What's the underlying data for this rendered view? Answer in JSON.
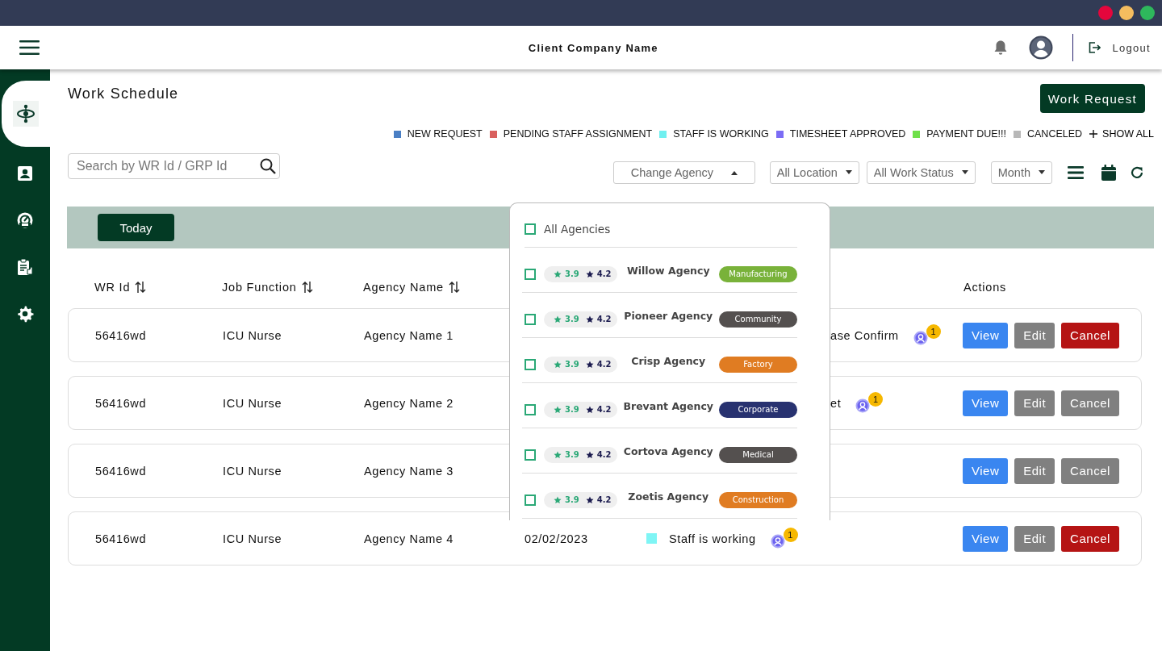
{
  "window": {
    "controls": [
      {
        "color": "#e5063c"
      },
      {
        "color": "#f5bd5f"
      },
      {
        "color": "#2eb85c"
      }
    ]
  },
  "header": {
    "company": "Client Company Name",
    "logout": "Logout"
  },
  "sidebar": {
    "items": [
      {
        "kind": "hub",
        "selected": true
      },
      {
        "kind": "contact",
        "selected": false
      },
      {
        "kind": "gauge",
        "selected": false
      },
      {
        "kind": "clipboard",
        "selected": false
      },
      {
        "kind": "settings",
        "selected": false
      }
    ]
  },
  "page": {
    "title": "Work Schedule",
    "action": "Work Request"
  },
  "legend": [
    {
      "label": "NEW REQUEST",
      "color": "#4a7fc4"
    },
    {
      "label": "PENDING STAFF ASSIGNMENT",
      "color": "#d9605e"
    },
    {
      "label": "STAFF IS WORKING",
      "color": "#70f0f0"
    },
    {
      "label": "TIMESHEET APPROVED",
      "color": "#7b6cf5"
    },
    {
      "label": "PAYMENT DUE!!!",
      "color": "#6fe04a"
    },
    {
      "label": "CANCELED",
      "color": "#b8b8b8"
    }
  ],
  "show_all": "SHOW ALL",
  "search": {
    "placeholder": "Search by WR Id / GRP Id"
  },
  "filters": [
    {
      "label": "Change Agency",
      "expanded": true,
      "kind": "wide"
    },
    {
      "label": "All Location",
      "expanded": false,
      "kind": "normal"
    },
    {
      "label": "All Work Status",
      "expanded": false,
      "kind": "normal"
    },
    {
      "label": "Month",
      "expanded": false,
      "kind": "separate"
    }
  ],
  "today": "Today",
  "table": {
    "columns": [
      {
        "label": "WR Id",
        "sortable": true
      },
      {
        "label": "Job Function",
        "sortable": true
      },
      {
        "label": "Agency Name",
        "sortable": true
      },
      {
        "label": "Actions",
        "sortable": false
      }
    ],
    "rows": [
      {
        "wr_id": "56416wd",
        "job_function": "ICU Nurse",
        "agency": "Agency Name 1",
        "kind": "partial",
        "status": "ase Confirm",
        "count": "1",
        "actions": [
          {
            "label": "View",
            "kind": "view"
          },
          {
            "label": "Edit",
            "kind": "edit"
          },
          {
            "label": "Cancel",
            "kind": "cancel",
            "disabled": false
          }
        ]
      },
      {
        "wr_id": "56416wd",
        "job_function": "ICU Nurse",
        "agency": "Agency Name 2",
        "kind": "partial",
        "status": "et",
        "count": "1",
        "actions": [
          {
            "label": "View",
            "kind": "view"
          },
          {
            "label": "Edit",
            "kind": "edit"
          },
          {
            "label": "Cancel",
            "kind": "cancel",
            "disabled": true
          }
        ]
      },
      {
        "wr_id": "56416wd",
        "job_function": "ICU Nurse",
        "agency": "Agency Name 3",
        "kind": "partial",
        "actions": [
          {
            "label": "View",
            "kind": "view"
          },
          {
            "label": "Edit",
            "kind": "edit"
          },
          {
            "label": "Cancel",
            "kind": "cancel",
            "disabled": true
          }
        ]
      },
      {
        "wr_id": "56416wd",
        "job_function": "ICU Nurse",
        "agency": "Agency Name 4",
        "kind": "full",
        "date": "02/02/2023",
        "status": "Staff is working",
        "color": "#7ff5f5",
        "count": "1",
        "actions": [
          {
            "label": "View",
            "kind": "view"
          },
          {
            "label": "Edit",
            "kind": "edit"
          },
          {
            "label": "Cancel",
            "kind": "cancel",
            "disabled": false
          }
        ]
      }
    ]
  },
  "agency_dropdown": {
    "all": {
      "label": "All Agencies",
      "checked": false
    },
    "items": [
      {
        "rating_1": "3.9",
        "rating_2": "4.2",
        "name": "Willow Agency",
        "tag": "Manufacturing",
        "color": "#79b23a",
        "checked": false
      },
      {
        "rating_1": "3.9",
        "rating_2": "4.2",
        "name": "Pioneer Agency",
        "tag": "Community",
        "color": "#54504f",
        "checked": false
      },
      {
        "rating_1": "3.9",
        "rating_2": "4.2",
        "name": "Crisp Agency",
        "tag": "Factory",
        "color": "#e07c22",
        "checked": false
      },
      {
        "rating_1": "3.9",
        "rating_2": "4.2",
        "name": "Brevant Agency",
        "tag": "Corporate",
        "color": "#283270",
        "checked": false
      },
      {
        "rating_1": "3.9",
        "rating_2": "4.2",
        "name": "Cortova Agency",
        "tag": "Medical",
        "color": "#54504f",
        "checked": false
      },
      {
        "rating_1": "3.9",
        "rating_2": "4.2",
        "name": "Zoetis Agency",
        "tag": "Construction",
        "color": "#e07c22",
        "checked": false
      }
    ]
  }
}
